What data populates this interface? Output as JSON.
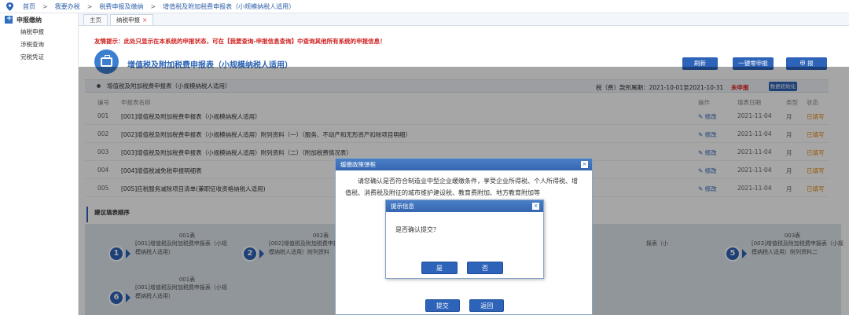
{
  "breadcrumb": [
    "首页",
    "我要办税",
    "税费申报及缴纳",
    "增值税及附加税费申报表（小规模纳税人适用）"
  ],
  "sidebar": {
    "title": "申报缴纳",
    "items": [
      {
        "label": "纳税申报"
      },
      {
        "label": "涉税查询"
      },
      {
        "label": "完税凭证"
      }
    ]
  },
  "tabs": [
    {
      "label": "主页"
    },
    {
      "label": "纳税申报",
      "close": "×"
    }
  ],
  "hint": "友情提示：此处只显示在本系统的申报状态，可在【我要查询-申报信息查询】中查询其他所有系统的申报信息！",
  "header": {
    "title": "增值税及附加税费申报表（小规模纳税人适用）",
    "refresh_label": "刷新",
    "zero_label": "一键零申报",
    "submit_label": "申 报"
  },
  "period_bar": {
    "label": "增值税及附加税费申报表（小规模纳税人适用）",
    "period": "税（费）款所属期：2021-10-01至2021-10-31",
    "status": "未申报",
    "init_label": "数据初始化"
  },
  "table": {
    "headers": {
      "no": "编号",
      "name": "申报表名称",
      "op": "操作",
      "date": "填表日期",
      "type": "类型",
      "status": "状态"
    },
    "rows": [
      {
        "no": "001",
        "name": "[001]增值税及附加税费申报表（小规模纳税人适用）",
        "op": "修改",
        "date": "2021-11-04",
        "type": "月",
        "status": "已填写"
      },
      {
        "no": "002",
        "name": "[002]增值税及附加税费申报表（小规模纳税人适用）附列资料（一）（服务、不动产和无形资产扣除项目明细）",
        "op": "修改",
        "date": "2021-11-04",
        "type": "月",
        "status": "已填写"
      },
      {
        "no": "003",
        "name": "[003]增值税及附加税费申报表（小规模纳税人适用）附列资料（二）（附加税费情况表）",
        "op": "修改",
        "date": "2021-11-04",
        "type": "月",
        "status": "已填写"
      },
      {
        "no": "004",
        "name": "[004]增值税减免税申报明细表",
        "op": "修改",
        "date": "2021-11-04",
        "type": "月",
        "status": "已填写"
      },
      {
        "no": "005",
        "name": "[005]应税服务减除项目清单(兼职征收资格纳税人适用)",
        "op": "修改",
        "date": "2021-11-04",
        "type": "月",
        "status": "已填写"
      }
    ]
  },
  "suggest": {
    "title": "建议填表顺序",
    "steps": [
      {
        "num": "1",
        "code": "001表",
        "text": "[001]增值税及附加税费申报表（小规模纳税人适用）"
      },
      {
        "num": "2",
        "code": "002表",
        "text": "[002]增值税及附加税费申报表（小规模纳税人适用）附列资料"
      },
      {
        "num": "5",
        "code": "003表",
        "text": "[003]增值税及附加税费申报表（小规模纳税人适用）附列资料二",
        "partial": "报表（小"
      },
      {
        "num": "6",
        "code": "001表",
        "text": "[001]增值税及附加税费申报表（小规模纳税人适用）"
      }
    ]
  },
  "dialog_relief": {
    "title": "缓缴政策弹框",
    "close": "×",
    "body": "请您确认是否符合制造业中型企业缓缴条件，享受企业所得税、个人所得税、增值税、消费税及附征的城市维护建设税、教育费附加、地方教育附加等",
    "submit_label": "提交",
    "back_label": "返回"
  },
  "dialog_confirm": {
    "title": "提示信息",
    "close": "×",
    "message": "是否确认提交？",
    "yes_label": "是",
    "no_label": "否"
  }
}
